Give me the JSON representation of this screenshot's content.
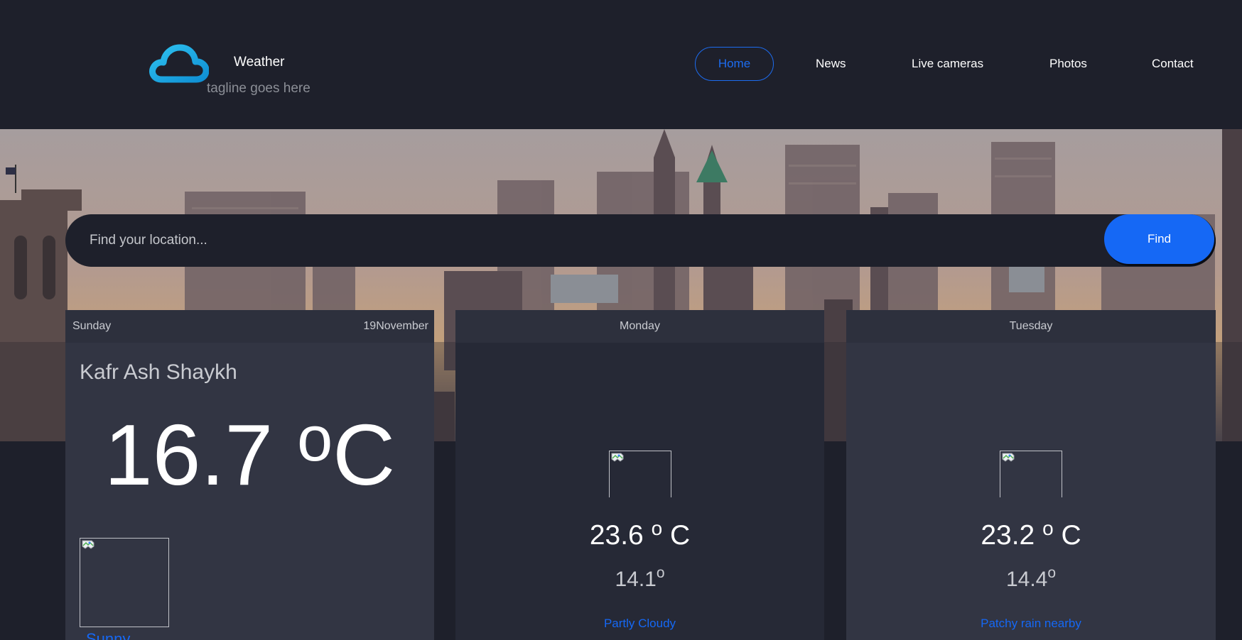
{
  "brand": {
    "title": "Weather",
    "tagline": "tagline goes here",
    "logo_icon": "cloud-icon",
    "accent_color": "#1fa7e0"
  },
  "nav": {
    "items": [
      {
        "label": "Home",
        "active": true
      },
      {
        "label": "News"
      },
      {
        "label": "Live cameras"
      },
      {
        "label": "Photos"
      },
      {
        "label": "Contact"
      }
    ],
    "active_color": "#1d6cf0"
  },
  "search": {
    "placeholder": "Find your location...",
    "value": "",
    "button_label": "Find"
  },
  "today": {
    "day": "Sunday",
    "date": "19November",
    "location": "Kafr Ash Shaykh",
    "temp_value": "16.7 ",
    "temp_degree": "o",
    "temp_unit": "C",
    "condition": "Sunny"
  },
  "forecast": [
    {
      "day": "Monday",
      "max_value": "23.6 ",
      "max_degree": "o",
      "max_unit": " C",
      "min_value": "14.1",
      "min_degree": "o",
      "condition": "Partly Cloudy"
    },
    {
      "day": "Tuesday",
      "max_value": "23.2 ",
      "max_degree": "o",
      "max_unit": " C",
      "min_value": "14.4",
      "min_degree": "o",
      "condition": "Patchy rain nearby"
    }
  ],
  "colors": {
    "background": "#1e202b",
    "card": "#323543",
    "card_alt": "#262936",
    "link": "#1568f5"
  }
}
